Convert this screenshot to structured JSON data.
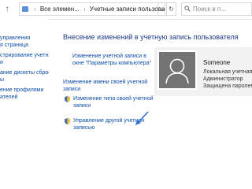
{
  "address_bar": {
    "path_segments": [
      "Все элемен...",
      "Учетные записи пользователей"
    ],
    "search_placeholder": "Поиск в п...",
    "refresh_label": "↻",
    "dropdown_label": "⌄"
  },
  "sidebar": {
    "items": [
      "управления",
      "я страница",
      "стрирование учетных",
      "и",
      "ание дискеты сброса",
      "ы",
      "ение профилями",
      "ателей"
    ]
  },
  "main": {
    "title": "Внесение изменений в учетную запись пользователя",
    "links": {
      "computer_settings_line1": "Изменение учетной записи в",
      "computer_settings_line2": "окне \"Параметры компьютера\"",
      "change_name_line1": "Изменение имени своей учетной",
      "change_name_line2": "записи",
      "change_type_line1": "Изменение типа своей учетной",
      "change_type_line2": "записи",
      "manage_other_line1": "Управление другой учетной",
      "manage_other_line2": "записью"
    }
  },
  "user": {
    "name": "Someone",
    "account_type": "Локальная учетная з...",
    "role": "Администратор",
    "password_status": "Защищена паролем"
  },
  "colors": {
    "link": "#0a4ba8",
    "title": "#1e3a8a",
    "avatar_bg": "#737373",
    "card_bg": "#f2f2f2",
    "annotation_arrow": "#2f6fd6"
  }
}
